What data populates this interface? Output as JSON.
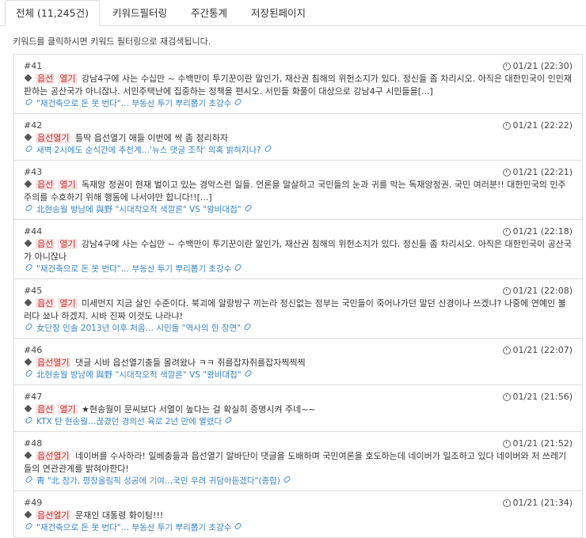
{
  "tabs": [
    {
      "label": "전체 (11,245건)",
      "active": true
    },
    {
      "label": "키워드필터링",
      "active": false
    },
    {
      "label": "주간통계",
      "active": false
    },
    {
      "label": "저장된페이지",
      "active": false
    }
  ],
  "hint": "키워드를 클릭하시면 키워드 필터링으로 재검색됩니다.",
  "entries": [
    {
      "num": "#41",
      "time": "01/21 (22:30)",
      "keywords": [
        "읍선",
        "열기"
      ],
      "text": "읍선 열기 강남4구에 사는 수십만 ~ 수백만이 투기꾼이란 말인가, 재산권 침해의 위헌소지가 있다. 정신들 좀 차리시오. 아직은 대한민국이 인민재판하는 공산국가 아니잖나. 서민주택난에 집중하는 정책을 편시오. 서민들 화풀이 대상으로 강남4구 시민들을[...]",
      "link": "\"재건축으로 돈 못 번다\"… 부동산 투기 뿌리뽑기 초강수"
    },
    {
      "num": "#42",
      "time": "01/21 (22:22)",
      "keywords": [
        "읍선열기"
      ],
      "text": "틀딱 읍선열기 애들 이번에 싹 좀 정리하자",
      "link": "새벽 2시에도 순식간에 추천계…'뉴스 댓글 조작' 의혹 밝혀지나?"
    },
    {
      "num": "#43",
      "time": "01/21 (22:21)",
      "keywords": [
        "읍선",
        "열기"
      ],
      "text": "읍선 열기 독재앙 정권이 현재 벌이고 있는 경악스런 일들. 언론을 말살하고 국민들의 눈과 귀를 막는 독재앙정권. 국민 여러분!! 대한민국의 민주주의를 수호하기 위해 행동에 나서야만 합니다!![...]",
      "link": "北현송월 방남에 與野 \"시대착오적 색깔론\" VS \"왕비대접\""
    },
    {
      "num": "#44",
      "time": "01/21 (22:18)",
      "keywords": [
        "읍선",
        "열기"
      ],
      "text": "읍선 열기 강남4구에 사는 수십만 ~ 수백만이 투기꾼이란 말인가, 재산권 침해의 위헌소지가 있다. 정신들 좀 차리시오. 아직은 대한민국이 공산국가 아니잖나",
      "link": "\"재건축으로 돈 못 번다\"… 부동산 투기 뿌리뽑기 초강수"
    },
    {
      "num": "#45",
      "time": "01/21 (22:08)",
      "keywords": [
        "읍선",
        "열기"
      ],
      "text": "읍선 열기 미세먼지 지금 살인 수준이다. 북괴에 알랑방구 끼는라 정신없는 정부는 국민들이 죽어나가던 말던 신경이나 쓰겠냐? 나중에 연예인 불러다 쑈나 하겠지. 시바 진짜 이것도 나라냐!",
      "link": "女단장 인솔 2013년 이후 처음… 시민들 \"역사의 한 장면\""
    },
    {
      "num": "#46",
      "time": "01/21 (22:07)",
      "keywords": [
        "읍선열기"
      ],
      "text": "댓글 시바 읍선열기충들 몰려왔나 ㅋㅋ 쥐를잡자쥐를잡자찍찍찍",
      "link": "北현송월 방남에 與野 \"시대착오적 색깔론\" VS \"왕비대접\""
    },
    {
      "num": "#47",
      "time": "01/21 (21:56)",
      "keywords": [
        "읍선",
        "열기"
      ],
      "text": "읍선 열기 ★현송월이 문씨보다 서열이 높다는 걸 확실히 증명시켜 주네~~",
      "link": "KTX 탄 현송월…끊겼던 경의선 육로 2년 만에 열렸다"
    },
    {
      "num": "#48",
      "time": "01/21 (21:52)",
      "keywords": [
        "읍선열기"
      ],
      "text": "네이버를 수사하라! 일베충들과 읍선열기 알바단이 댓글을 도배하며 국민여론을 호도하는데 네이버가 일조하고 있다 네이버와 저 쓰레기들의 연관관계를 밝혀야한다!",
      "link": "靑 \"北 참가, 평창올림픽 성공에 기여…국민 우려 귀담아듣겠다\"(종합)"
    },
    {
      "num": "#49",
      "time": "01/21 (21:34)",
      "keywords": [
        "읍선열기"
      ],
      "text": "읍선열기 문재인 대통령 화이팅!!!",
      "link": "\"재건축으로 돈 못 번다\"… 부동산 투기 뿌리뽑기 초강수"
    }
  ]
}
